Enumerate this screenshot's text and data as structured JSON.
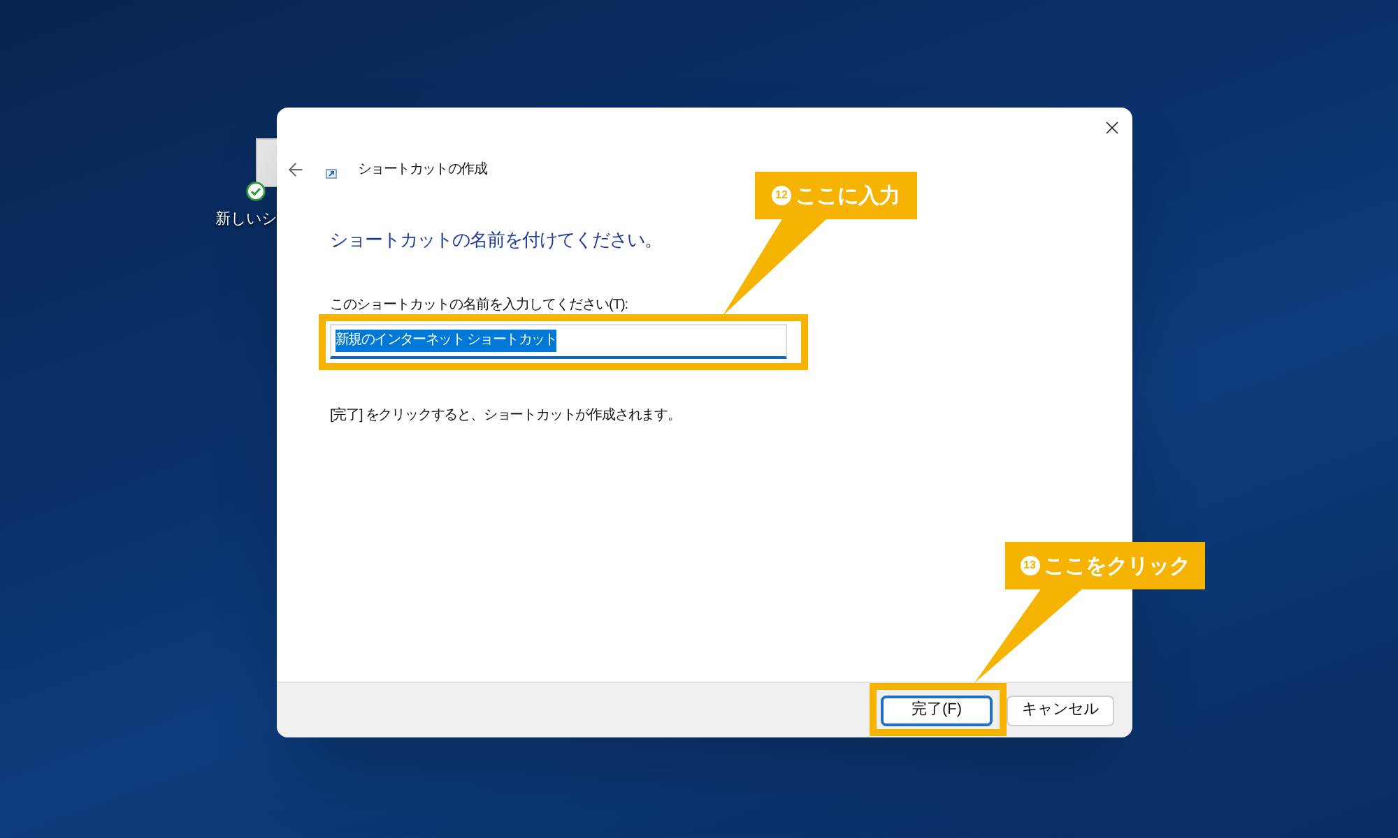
{
  "desktop_icons": [
    {
      "label": "新しいシ"
    }
  ],
  "dialog": {
    "title": "ショートカットの作成",
    "heading": "ショートカットの名前を付けてください。",
    "name_field": {
      "label": "このショートカットの名前を入力してください(T):",
      "value": "新規のインターネット ショートカット",
      "text_selected": true,
      "annotation": {
        "number": "12",
        "text": "ここに入力"
      }
    },
    "note": "[完了] をクリックすると、ショートカットが作成されます。",
    "buttons": [
      {
        "label": "完了(F)",
        "default": true,
        "annotation": {
          "number": "13",
          "text": "ここをクリック"
        }
      },
      {
        "label": "キャンセル",
        "default": false
      }
    ]
  }
}
